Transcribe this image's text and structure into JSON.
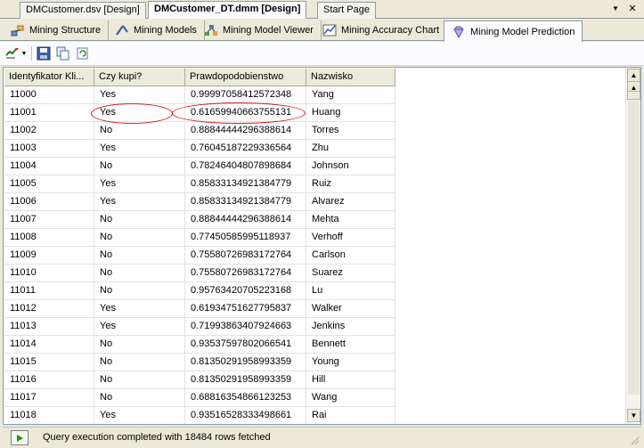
{
  "doc_tabs": [
    {
      "label": "DMCustomer.dsv [Design]",
      "active": false
    },
    {
      "label": "DMCustomer_DT.dmm [Design]",
      "active": true
    },
    {
      "label": "Start Page",
      "active": false
    }
  ],
  "doc_tab_controls": {
    "dropdown": "▼",
    "close": "✕"
  },
  "designer_tabs": [
    {
      "label": "Mining Structure",
      "icon": "mining-structure-icon"
    },
    {
      "label": "Mining Models",
      "icon": "mining-models-icon"
    },
    {
      "label": "Mining Model Viewer",
      "icon": "mining-model-viewer-icon"
    },
    {
      "label": "Mining Accuracy Chart",
      "icon": "accuracy-chart-icon"
    },
    {
      "label": "Mining Model Prediction",
      "icon": "prediction-gem-icon",
      "active": true
    }
  ],
  "toolbar": {
    "buttons": [
      "design-view-icon",
      "save-icon",
      "copy-results-icon",
      "refresh-icon"
    ]
  },
  "grid": {
    "columns": [
      "Identyfikator Kli...",
      "Czy kupi?",
      "Prawdopodobienstwo",
      "Nazwisko"
    ],
    "rows": [
      [
        "11000",
        "Yes",
        "0.99997058412572348",
        "Yang"
      ],
      [
        "11001",
        "Yes",
        "0.61659940663755131",
        "Huang"
      ],
      [
        "11002",
        "No",
        "0.88844444296388614",
        "Torres"
      ],
      [
        "11003",
        "Yes",
        "0.76045187229336564",
        "Zhu"
      ],
      [
        "11004",
        "No",
        "0.78246404807898684",
        "Johnson"
      ],
      [
        "11005",
        "Yes",
        "0.85833134921384779",
        "Ruiz"
      ],
      [
        "11006",
        "Yes",
        "0.85833134921384779",
        "Alvarez"
      ],
      [
        "11007",
        "No",
        "0.88844444296388614",
        "Mehta"
      ],
      [
        "11008",
        "No",
        "0.77450585995118937",
        "Verhoff"
      ],
      [
        "11009",
        "No",
        "0.75580726983172764",
        "Carlson"
      ],
      [
        "11010",
        "No",
        "0.75580726983172764",
        "Suarez"
      ],
      [
        "11011",
        "No",
        "0.95763420705223168",
        "Lu"
      ],
      [
        "11012",
        "Yes",
        "0.61934751627795837",
        "Walker"
      ],
      [
        "11013",
        "Yes",
        "0.71993863407924663",
        "Jenkins"
      ],
      [
        "11014",
        "No",
        "0.93537597802066541",
        "Bennett"
      ],
      [
        "11015",
        "No",
        "0.81350291958993359",
        "Young"
      ],
      [
        "11016",
        "No",
        "0.81350291958993359",
        "Hill"
      ],
      [
        "11017",
        "No",
        "0.68816354866123253",
        "Wang"
      ],
      [
        "11018",
        "Yes",
        "0.93516528333498661",
        "Rai"
      ]
    ],
    "highlighted_row": 1,
    "highlight_color": "#d21a1a"
  },
  "scrollbar": {
    "up": "▲",
    "down": "▼"
  },
  "status": {
    "text": "Query execution completed with 18484 rows fetched",
    "run_icon": "play-icon",
    "run_color": "#1a9a1a"
  }
}
